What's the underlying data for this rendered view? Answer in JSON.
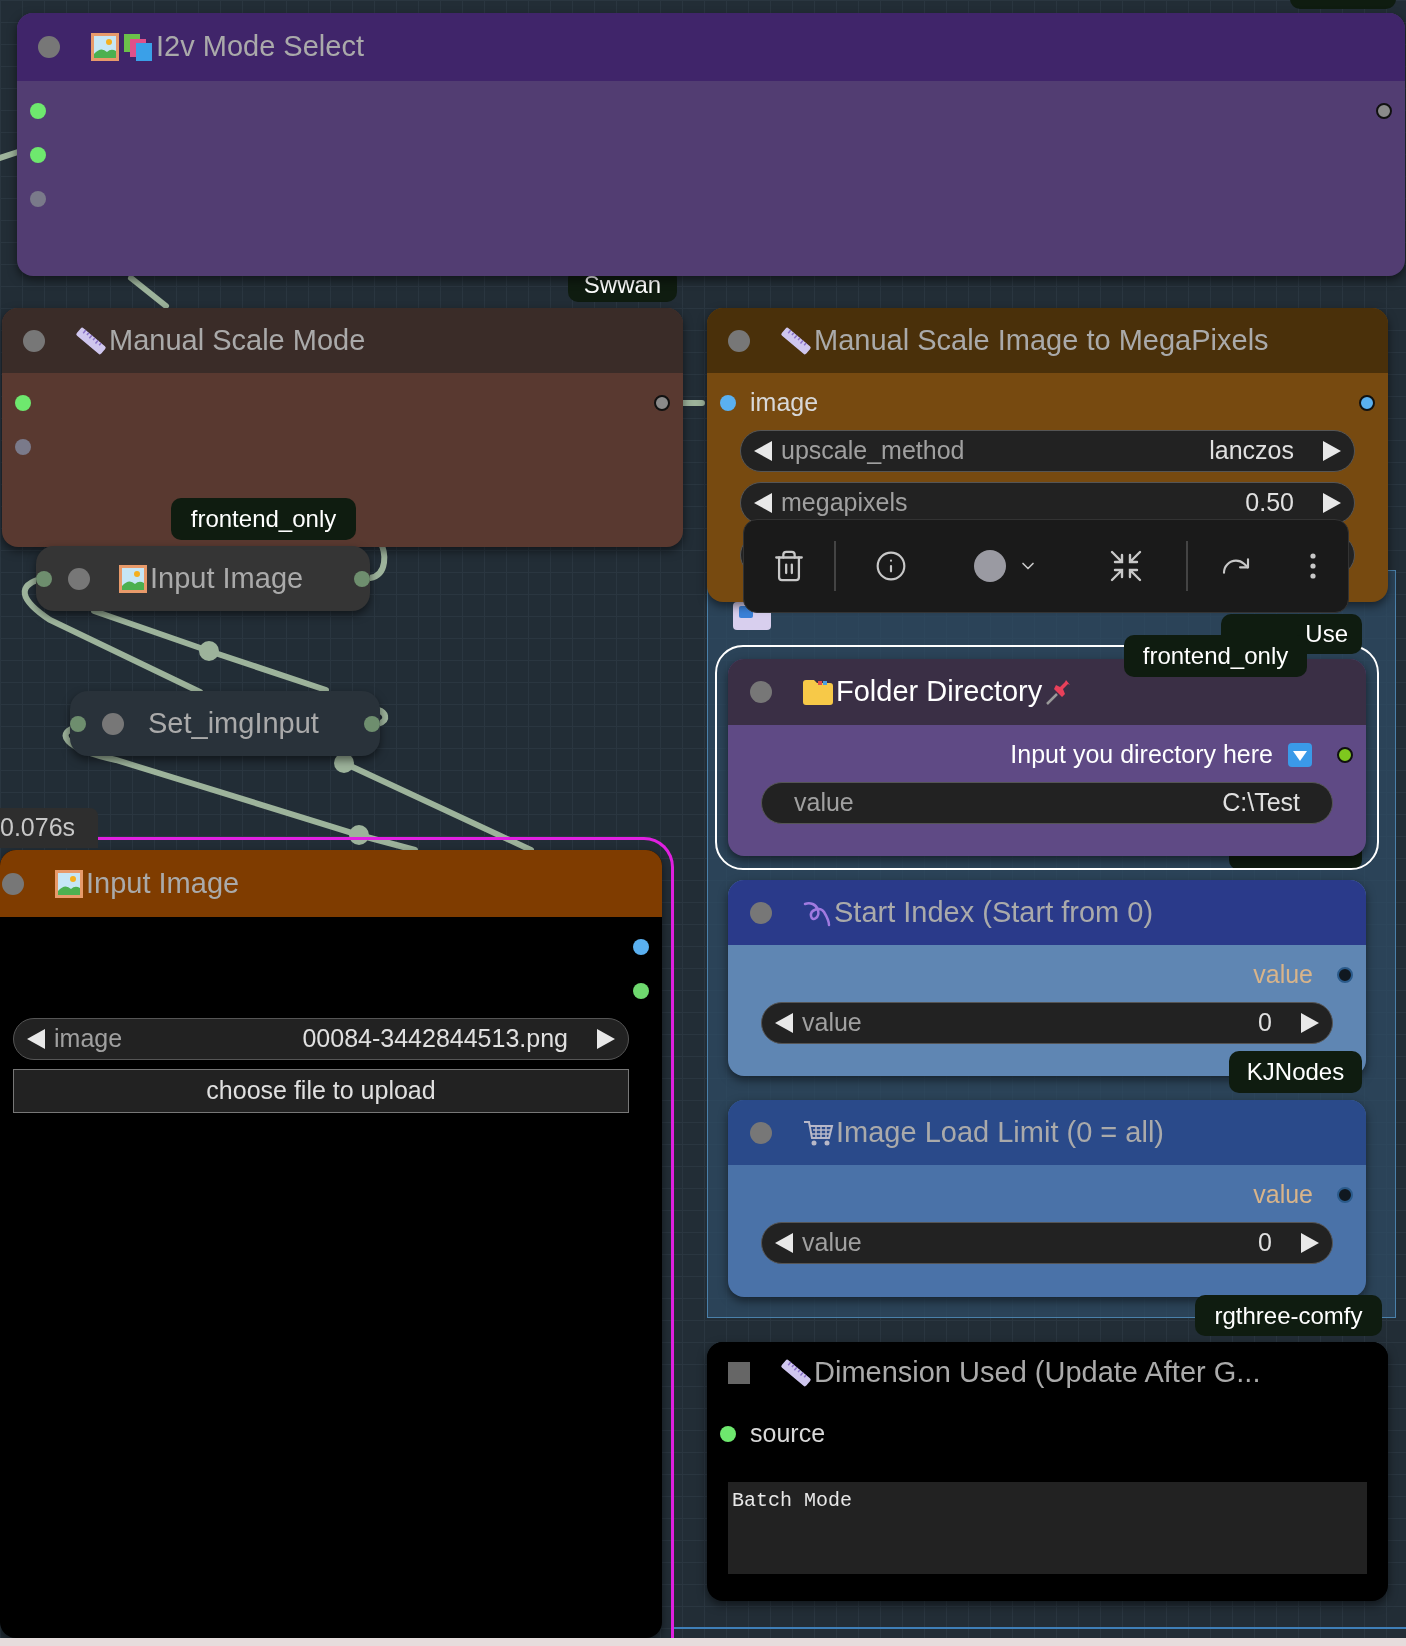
{
  "nodes": [
    {
      "kind": "node",
      "title": "I2v Mode Select",
      "selected": false,
      "inputs": [
        {
          "color": "#6ee86e"
        },
        {
          "color": "#6ee86e"
        },
        {
          "color": "#7a7a8a"
        }
      ],
      "outputs": [
        {
          "color": "#8a8a8a"
        }
      ]
    },
    {
      "kind": "node",
      "title": "Manual Scale Mode",
      "selected": false,
      "inputs": [
        {
          "color": "#6ee86e"
        },
        {
          "color": "#7a7a8a"
        }
      ],
      "outputs": [
        {
          "color": "#8a8a8a"
        }
      ]
    },
    {
      "kind": "collapsed",
      "title": "Input Image",
      "selected": false,
      "inputs": [
        {
          "color": "#6e8e6e"
        }
      ],
      "outputs": [
        {
          "color": "#6e8e6e"
        }
      ]
    },
    {
      "kind": "collapsed",
      "title": "Set_imgInput",
      "selected": false,
      "inputs": [
        {
          "color": "#6e8e6e"
        }
      ],
      "outputs": [
        {
          "color": "#6e8e6e"
        }
      ]
    },
    {
      "kind": "node",
      "title": "Input Image",
      "selected": false,
      "outputs": [
        {
          "color": "#5ab0f0"
        },
        {
          "color": "#6ed86e"
        }
      ],
      "widgets": [
        {
          "kind": "combo",
          "label": "image",
          "value": "00084-3442844513.png"
        },
        {
          "kind": "button",
          "label": "choose file to upload"
        }
      ]
    },
    {
      "kind": "node",
      "title": "Manual Scale Image to MegaPixels",
      "selected": false,
      "inputs": [
        {
          "color": "#5ab0f0",
          "label": "image"
        }
      ],
      "outputs": [
        {
          "color": "#5ab0f0"
        }
      ],
      "widgets": [
        {
          "kind": "combo",
          "label": "upscale_method",
          "value": "lanczos"
        },
        {
          "kind": "number",
          "label": "megapixels",
          "value": "0.50"
        }
      ]
    },
    {
      "kind": "node",
      "title": "Folder Directory",
      "selected": true,
      "outputs": [
        {
          "color": "#7ec81e",
          "label": "Input you directory here"
        }
      ],
      "widgets": [
        {
          "kind": "text",
          "label": "value",
          "value": "C:\\Test"
        }
      ]
    },
    {
      "kind": "node",
      "title": "Start Index (Start from 0)",
      "selected": false,
      "outputs": [
        {
          "color": "#2a5a8a",
          "label": "value"
        }
      ],
      "widgets": [
        {
          "kind": "number",
          "label": "value",
          "value": "0"
        }
      ]
    },
    {
      "kind": "node",
      "title": "Image Load Limit (0 = all)",
      "selected": false,
      "outputs": [
        {
          "color": "#2a5a8a",
          "label": "value"
        }
      ],
      "widgets": [
        {
          "kind": "number",
          "label": "value",
          "value": "0"
        }
      ]
    },
    {
      "kind": "node",
      "title": "Dimension Used (Update After G...",
      "selected": false,
      "inputs": [
        {
          "color": "#6ee86e",
          "label": "source"
        }
      ],
      "widgets": [
        {
          "kind": "textarea",
          "value": "Batch Mode"
        }
      ]
    }
  ],
  "badges": [
    {
      "text": "Swwan"
    },
    {
      "text": "frontend_only"
    },
    {
      "text": "Use"
    },
    {
      "text": "frontend_only"
    },
    {
      "text": "KJNodes"
    },
    {
      "text": "rgthree-comfy"
    }
  ],
  "execution_time": "0.076s"
}
